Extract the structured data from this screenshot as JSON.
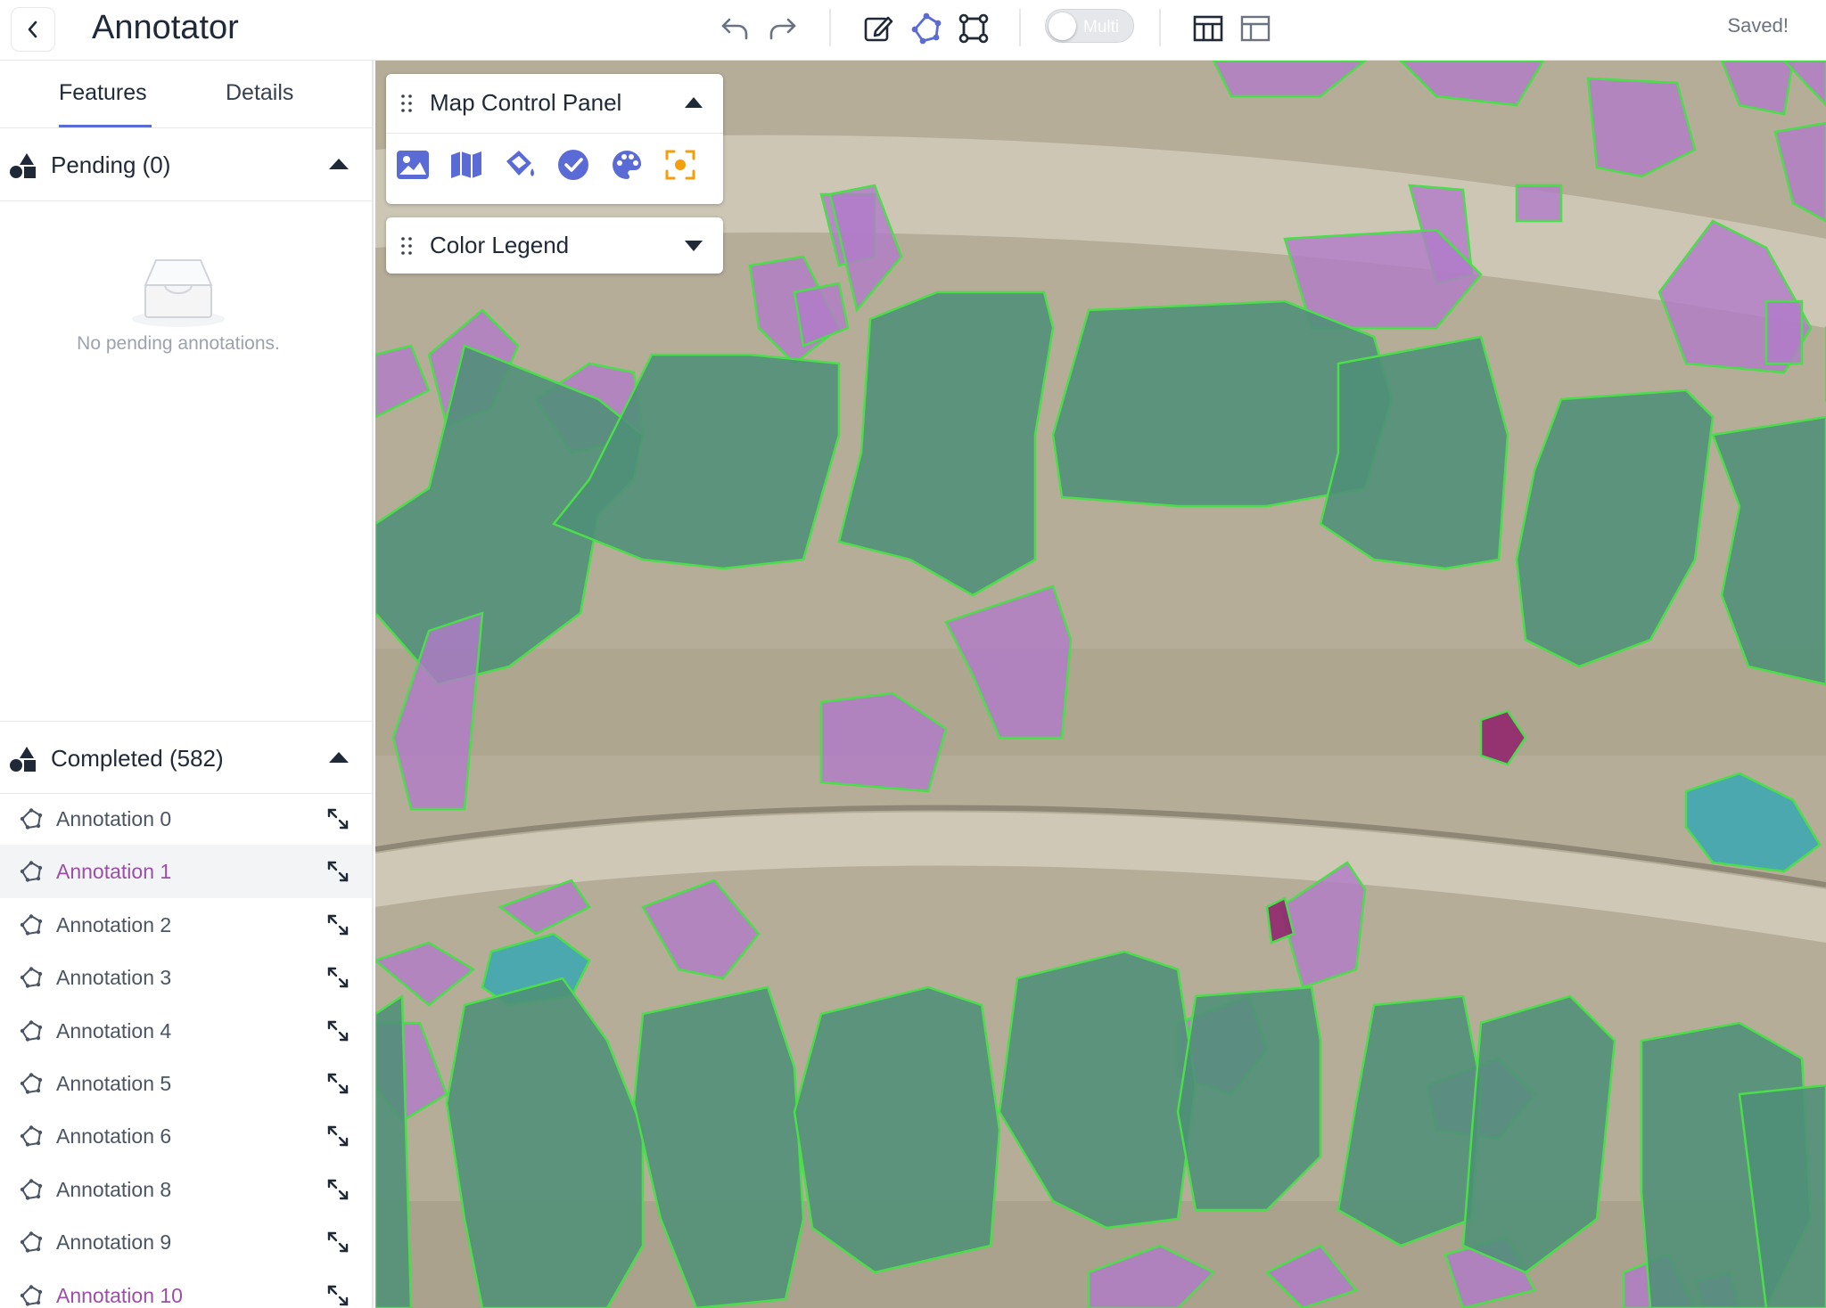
{
  "app": {
    "title": "Annotator",
    "status": "Saved!"
  },
  "toolbar": {
    "multi_label": "Multi"
  },
  "sidebar": {
    "tabs": [
      {
        "label": "Features"
      },
      {
        "label": "Details"
      }
    ],
    "pending": {
      "title": "Pending (0)",
      "empty_text": "No pending annotations."
    },
    "completed": {
      "title": "Completed (582)",
      "items": [
        {
          "label": "Annotation 0"
        },
        {
          "label": "Annotation 1"
        },
        {
          "label": "Annotation 2"
        },
        {
          "label": "Annotation 3"
        },
        {
          "label": "Annotation 4"
        },
        {
          "label": "Annotation 5"
        },
        {
          "label": "Annotation 6"
        },
        {
          "label": "Annotation 8"
        },
        {
          "label": "Annotation 9"
        },
        {
          "label": "Annotation 10"
        }
      ]
    }
  },
  "map_panels": {
    "control": {
      "title": "Map Control Panel"
    },
    "legend": {
      "title": "Color Legend"
    }
  },
  "colors": {
    "accent": "#5b6bd6",
    "building_fill": "#4f8f78",
    "tree_fill": "#b27bc9",
    "pool_fill": "#3aa7b3",
    "outline": "#4ade4a",
    "selected_text": "#9b4fa6"
  }
}
